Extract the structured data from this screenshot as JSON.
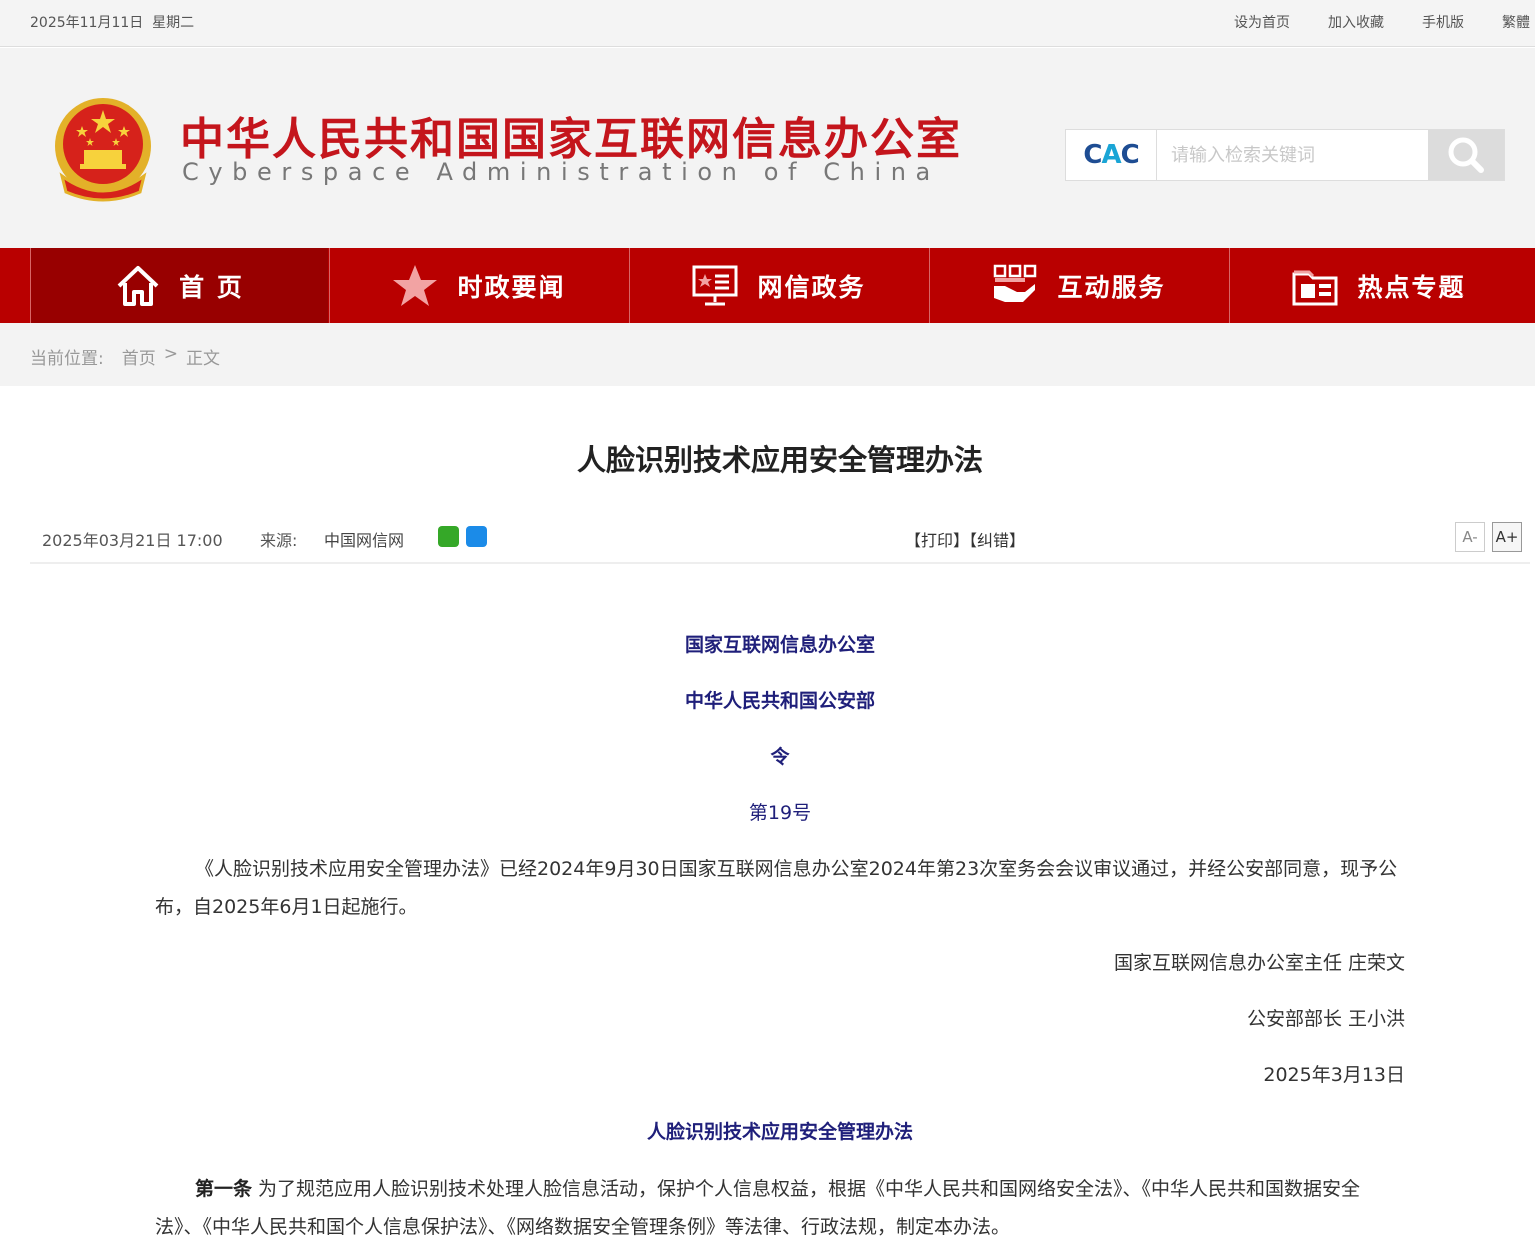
{
  "topbar": {
    "date": "2025年11月11日",
    "weekday": "星期二",
    "links": [
      "设为首页",
      "加入收藏",
      "手机版",
      "繁體"
    ]
  },
  "header": {
    "site_title": "中华人民共和国国家互联网信息办公室",
    "site_subtitle": "Cyberspace Administration of China",
    "search_logo_a": "C",
    "search_logo_b": "A",
    "search_logo_c": "C",
    "search_placeholder": "请输入检索关键词"
  },
  "nav": {
    "items": [
      {
        "label": "首 页",
        "icon": "home-icon",
        "active": true
      },
      {
        "label": "时政要闻",
        "icon": "star-icon",
        "active": false
      },
      {
        "label": "网信政务",
        "icon": "screen-icon",
        "active": false
      },
      {
        "label": "互动服务",
        "icon": "hand-icon",
        "active": false
      },
      {
        "label": "热点专题",
        "icon": "folder-icon",
        "active": false
      }
    ]
  },
  "breadcrumb": {
    "label": "当前位置:",
    "home": "首页",
    "sep": ">",
    "current": "正文"
  },
  "article": {
    "title": "人脸识别技术应用安全管理办法",
    "date": "2025年03月21日  17:00",
    "source_label": "来源:",
    "source": "中国网信网",
    "print": "【打印】",
    "correct": "【纠错】",
    "font_smaller": "A-",
    "font_larger": "A+",
    "issuer1": "国家互联网信息办公室",
    "issuer2": "中华人民共和国公安部",
    "order": "令",
    "number": "第19号",
    "para1": "《人脸识别技术应用安全管理办法》已经2024年9月30日国家互联网信息办公室2024年第23次室务会会议审议通过，并经公安部同意，现予公布，自2025年6月1日起施行。",
    "sign1": "国家互联网信息办公室主任 庄荣文",
    "sign2": "公安部部长 王小洪",
    "sign_date": "2025年3月13日",
    "subtitle": "人脸识别技术应用安全管理办法",
    "art1_head": "第一条",
    "art1_text": " 为了规范应用人脸识别技术处理人脸信息活动，保护个人信息权益，根据《中华人民共和国网络安全法》、《中华人民共和国数据安全法》、《中华人民共和国个人信息保护法》、《网络数据安全管理条例》等法律、行政法规，制定本办法。"
  },
  "colors": {
    "brand_red": "#b90000",
    "title_red": "#c4151c",
    "issuer_blue": "#1f1f7a"
  }
}
